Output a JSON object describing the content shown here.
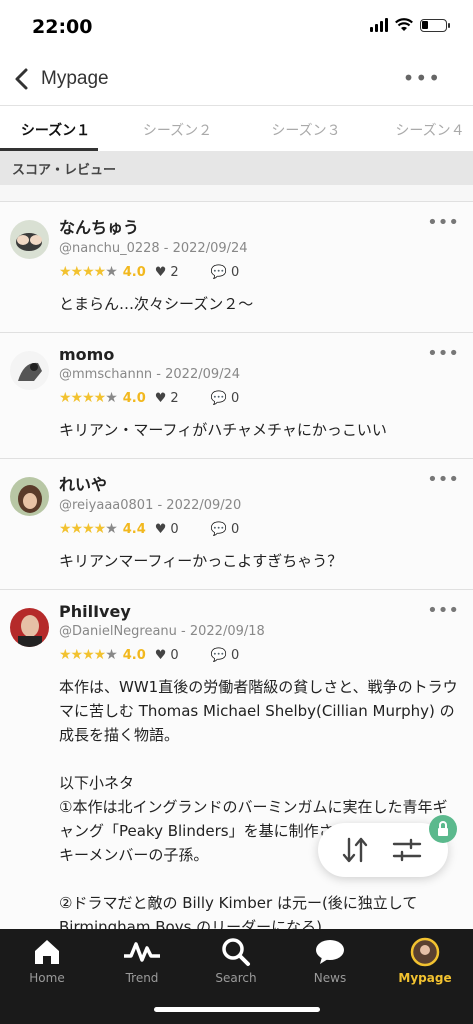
{
  "status": {
    "time": "22:00"
  },
  "nav": {
    "title": "Mypage",
    "more": "•••"
  },
  "tabs": [
    "シーズン１",
    "シーズン２",
    "シーズン３",
    "シーズン４"
  ],
  "section_title": "スコア・レビュー",
  "reviews": [
    {
      "name": "なんちゅう",
      "meta": "@nanchu_0228 - 2022/09/24",
      "score": "4.0",
      "stars": 4,
      "likes": "2",
      "comments": "0",
      "body": "とまらん…次々シーズン２〜"
    },
    {
      "name": "momo",
      "meta": "@mmschannn - 2022/09/24",
      "score": "4.0",
      "stars": 4,
      "likes": "2",
      "comments": "0",
      "body": "キリアン・マーフィがハチャメチャにかっこいい"
    },
    {
      "name": "れいや",
      "meta": "@reiyaaa0801 - 2022/09/20",
      "score": "4.4",
      "stars": 4,
      "likes": "0",
      "comments": "0",
      "body": "キリアンマーフィーかっこよすぎちゃう？"
    },
    {
      "name": "PhilIvey",
      "meta": "@DanielNegreanu - 2022/09/18",
      "score": "4.0",
      "stars": 4,
      "likes": "0",
      "comments": "0",
      "body": "本作は、WW1直後の労働者階級の貧しさと、戦争のトラウマに苦しむ Thomas Michael Shelby(Cillian Murphy) の成長を描く物語。\n\n以下小ネタ\n①本作は北イングランドのバーミンガムに実在した青年ギャング「Peaky Blinders」を基に制作された。監督はピーキーメンバーの子孫。\n\n②ドラマだと敵の Billy Kimber は元ー(後に独立して Birmingham Boys のリーダーになる)"
    }
  ],
  "tabbar": [
    {
      "label": "Home",
      "icon": "home-icon"
    },
    {
      "label": "Trend",
      "icon": "trend-icon"
    },
    {
      "label": "Search",
      "icon": "search-icon"
    },
    {
      "label": "News",
      "icon": "chat-bubble-icon"
    },
    {
      "label": "Mypage",
      "icon": "avatar-icon"
    }
  ],
  "colors": {
    "accent": "#f2c230",
    "lock": "#5bb98d",
    "tabbar_bg": "#1a1a1a"
  }
}
